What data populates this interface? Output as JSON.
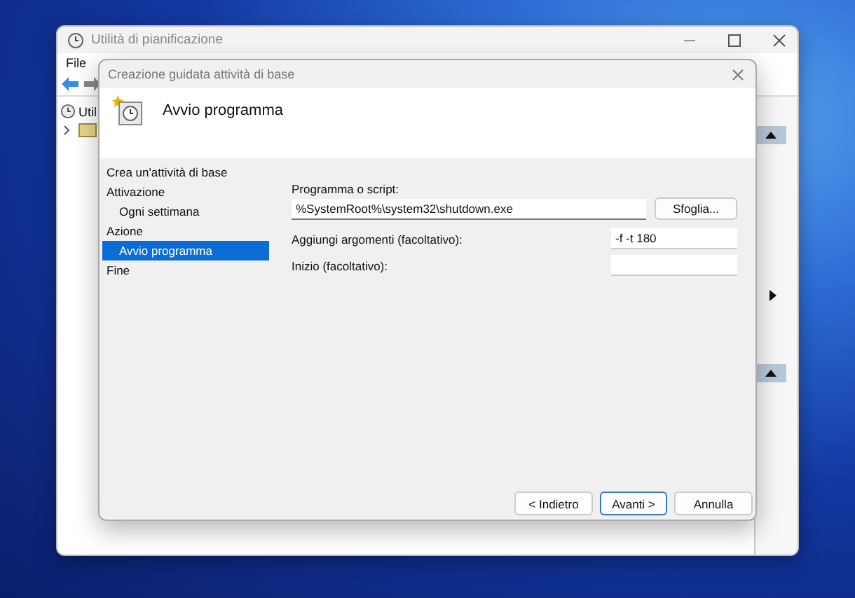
{
  "background_window": {
    "title": "Utilità di pianificazione",
    "menu": [
      "File"
    ],
    "tree_root": "Util"
  },
  "wizard": {
    "title": "Creazione guidata attività di base",
    "header": "Avvio programma",
    "steps": [
      {
        "label": "Crea un'attività di base",
        "selected": false
      },
      {
        "label": "Attivazione",
        "selected": false,
        "children": [
          {
            "label": "Ogni settimana",
            "selected": false
          }
        ]
      },
      {
        "label": "Azione",
        "selected": false,
        "children": [
          {
            "label": "Avvio programma",
            "selected": true
          }
        ]
      },
      {
        "label": "Fine",
        "selected": false
      }
    ],
    "fields": [
      {
        "kind": "wide",
        "label": "Programma o script:",
        "value": "%SystemRoot%\\system32\\shutdown.exe"
      },
      {
        "kind": "inline",
        "label": "Aggiungi argomenti (facoltativo):",
        "value": "-f -t 180"
      },
      {
        "kind": "inline",
        "label": "Inizio (facoltativo):"
      }
    ],
    "browse_button": "Sfoglia...",
    "buttons": [
      {
        "label": "< Indietro",
        "default": false
      },
      {
        "label": "Avanti >",
        "default": true
      },
      {
        "label": "Annulla",
        "default": false
      }
    ]
  }
}
